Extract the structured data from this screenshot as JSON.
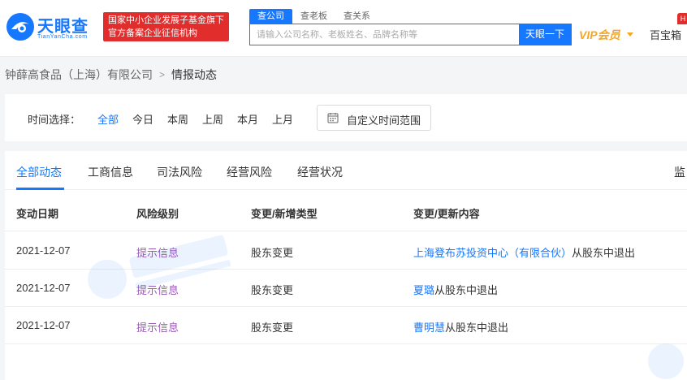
{
  "header": {
    "logo_text": "天眼查",
    "logo_sub": "TianYanCha.com",
    "badge_line1": "国家中小企业发展子基金旗下",
    "badge_line2": "官方备案企业征信机构",
    "search_tabs": [
      "查公司",
      "查老板",
      "查关系"
    ],
    "search_placeholder": "请输入公司名称、老板姓名、品牌名称等",
    "search_button": "天眼一下",
    "vip_label": "VIP会员",
    "toolbox_label": "百宝箱",
    "hot_tag": "H"
  },
  "breadcrumb": {
    "company": "钟薛高食品（上海）有限公司",
    "separator": ">",
    "current": "情报动态"
  },
  "time_filter": {
    "label": "时间选择：",
    "options": [
      "全部",
      "今日",
      "本周",
      "上周",
      "本月",
      "上月"
    ],
    "selected": "全部",
    "custom_button": "自定义时间范围"
  },
  "tabs": {
    "items": [
      "全部动态",
      "工商信息",
      "司法风险",
      "经营风险",
      "经营状况"
    ],
    "active": "全部动态",
    "right_partial": "监"
  },
  "table": {
    "headers": [
      "变动日期",
      "风险级别",
      "变更/新增类型",
      "变更/更新内容"
    ],
    "rows": [
      {
        "date": "2021-12-07",
        "risk": "提示信息",
        "type": "股东变更",
        "entity": "上海登布苏投资中心（有限合伙）",
        "action": "从股东中退出"
      },
      {
        "date": "2021-12-07",
        "risk": "提示信息",
        "type": "股东变更",
        "entity": "夏璐",
        "action": "从股东中退出"
      },
      {
        "date": "2021-12-07",
        "risk": "提示信息",
        "type": "股东变更",
        "entity": "曹明慧",
        "action": "从股东中退出"
      }
    ]
  },
  "colors": {
    "brand_blue": "#1677ff",
    "badge_red": "#e22d2d",
    "vip_orange": "#f5a623",
    "risk_purple": "#9b59b6"
  }
}
